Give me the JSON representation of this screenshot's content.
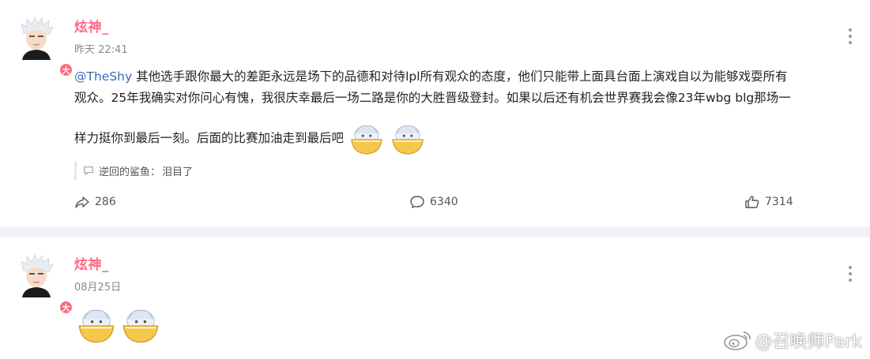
{
  "posts": [
    {
      "author": "炫神_",
      "badge": "大",
      "time": "昨天 22:41",
      "mention": "@TheShy",
      "lines": [
        " 其他选手跟你最大的差距永远是场下的品德和对待lpl所有观众的态度，他们只能带上面具台面上演戏自以为能够戏耍所有",
        "观众。25年我确实对你问心有愧，我很庆幸最后一场二路是你的大胜晋级登封。如果以后还有机会世界赛我会像23年wbg blg那场一",
        "样力挺你到最后一刻。后面的比赛加油走到最后吧"
      ],
      "emoji_name": "emoji-bowl",
      "comment": {
        "user": "逆回的鲨鱼",
        "sep": "：",
        "text": "泪目了"
      },
      "actions": {
        "share_count": "286",
        "comment_count": "6340",
        "like_count": "7314"
      }
    },
    {
      "author": "炫神_",
      "badge": "大",
      "time": "08月25日"
    }
  ],
  "watermark": "@召唤师Park",
  "colors": {
    "author": "#ff6a8a",
    "mention": "#3a6bb5",
    "badge": "#ff6a7e",
    "separator": "#f1f2f5"
  }
}
